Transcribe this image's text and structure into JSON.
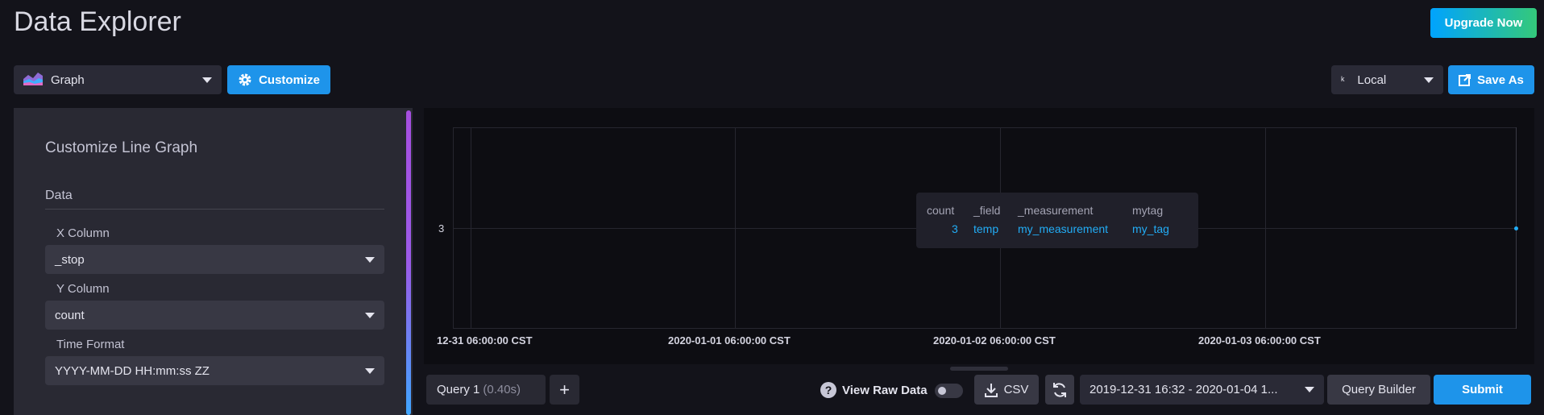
{
  "header": {
    "title": "Data Explorer",
    "upgrade_label": "Upgrade Now"
  },
  "toolbar": {
    "graph_type": "Graph",
    "customize_label": "Customize",
    "timezone": "Local",
    "save_as_label": "Save As"
  },
  "customize_panel": {
    "title": "Customize Line Graph",
    "section": "Data",
    "x_column": {
      "label": "X Column",
      "value": "_stop"
    },
    "y_column": {
      "label": "Y Column",
      "value": "count"
    },
    "time_format": {
      "label": "Time Format",
      "value": "YYYY-MM-DD HH:mm:ss ZZ"
    }
  },
  "graph": {
    "y_tick": "3",
    "x_ticks": [
      "12-31 06:00:00 CST",
      "2020-01-01 06:00:00 CST",
      "2020-01-02 06:00:00 CST",
      "2020-01-03 06:00:00 CST"
    ],
    "tooltip": {
      "headers": [
        "count",
        "_field",
        "_measurement",
        "mytag"
      ],
      "values": [
        "3",
        "temp",
        "my_measurement",
        "my_tag"
      ]
    }
  },
  "query_bar": {
    "query_tab": "Query 1",
    "query_time": "(0.40s)",
    "add_label": "+",
    "help_label": "?",
    "view_raw_label": "View Raw Data",
    "csv_label": "CSV",
    "time_range": "2019-12-31 16:32 - 2020-01-04 1...",
    "query_builder_label": "Query Builder",
    "submit_label": "Submit"
  },
  "colors": {
    "accent": "#1e94ea",
    "series": "#22adf6",
    "upgrade_gradient": [
      "#00a3ff",
      "#34c97a"
    ]
  }
}
